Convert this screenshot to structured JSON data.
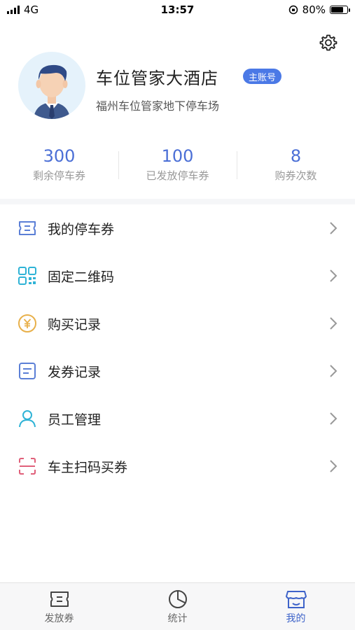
{
  "status_bar": {
    "carrier": "4G",
    "time": "13:57",
    "battery": "80%",
    "battery_level": 0.8
  },
  "profile": {
    "name": "车位管家大酒店",
    "badge": "主账号",
    "subtitle": "福州车位管家地下停车场"
  },
  "stats": [
    {
      "value": "300",
      "label": "剩余停车券"
    },
    {
      "value": "100",
      "label": "已发放停车券"
    },
    {
      "value": "8",
      "label": "购券次数"
    }
  ],
  "menu": [
    {
      "label": "我的停车券",
      "icon": "ticket-icon",
      "color": "#5b7fd6"
    },
    {
      "label": "固定二维码",
      "icon": "qrcode-icon",
      "color": "#2fb3d6"
    },
    {
      "label": "购买记录",
      "icon": "yen-coin-icon",
      "color": "#e8b04a"
    },
    {
      "label": "发券记录",
      "icon": "record-icon",
      "color": "#5b7fd6"
    },
    {
      "label": "员工管理",
      "icon": "user-icon",
      "color": "#2fb3d6"
    },
    {
      "label": "车主扫码买券",
      "icon": "scan-icon",
      "color": "#e0607a"
    }
  ],
  "tabs": [
    {
      "label": "发放券",
      "icon": "ticket-tab-icon",
      "active": false
    },
    {
      "label": "统计",
      "icon": "pie-chart-icon",
      "active": false
    },
    {
      "label": "我的",
      "icon": "shop-icon",
      "active": true
    }
  ],
  "colors": {
    "accent": "#4b6fd6",
    "badge": "#4b79e6",
    "active_tab": "#3e63c9"
  }
}
